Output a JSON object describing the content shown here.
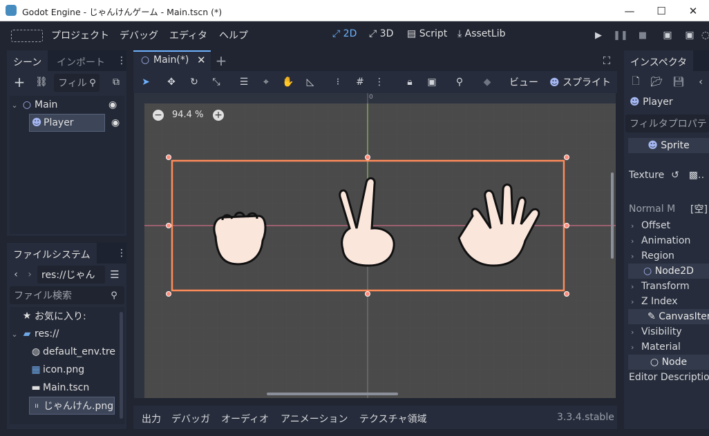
{
  "window": {
    "title": "Godot Engine - じゃんけんゲーム - Main.tscn (*)",
    "minimize": "—",
    "maximize": "☐",
    "close": "✕"
  },
  "menu": [
    "プロジェクト",
    "デバッグ",
    "エディタ",
    "ヘルプ"
  ],
  "workspaces": [
    "2D",
    "3D",
    "Script",
    "AssetLib"
  ],
  "scene_dock": {
    "tabs": [
      "シーン",
      "インポート"
    ],
    "filter_placeholder": "フィル",
    "nodes": [
      {
        "name": "Main"
      },
      {
        "name": "Player"
      }
    ]
  },
  "filesystem_dock": {
    "tab": "ファイルシステム",
    "path": "res://じゃん",
    "search_placeholder": "ファイル検索",
    "items": [
      {
        "label": "お気に入り:"
      },
      {
        "label": "res://"
      },
      {
        "label": "default_env.tre"
      },
      {
        "label": "icon.png"
      },
      {
        "label": "Main.tscn"
      },
      {
        "label": "じゃんけん.png"
      }
    ]
  },
  "editor": {
    "scene_tab": "Main(*)",
    "view_menu": "ビュー",
    "sprite_menu": "スプライト",
    "zoom": "94.4 %",
    "ruler_zero": "0"
  },
  "bottom_panel": {
    "tabs": [
      "出力",
      "デバッガ",
      "オーディオ",
      "アニメーション",
      "テクスチャ領域"
    ],
    "version": "3.3.4.stable"
  },
  "inspector": {
    "tab": "インスペクタ",
    "object": "Player",
    "filter_placeholder": "フィルタプロパテ",
    "sprite_section": "Sprite",
    "texture_label": "Texture",
    "normal_map_label": "Normal M",
    "normal_map_value": "[空]",
    "groups_a": [
      "Offset",
      "Animation",
      "Region"
    ],
    "node2d_section": "Node2D",
    "groups_b": [
      "Transform",
      "Z Index"
    ],
    "canvas_section": "CanvasIter",
    "groups_c": [
      "Visibility",
      "Material"
    ],
    "node_section": "Node",
    "editor_description": "Editor Description"
  },
  "colors": {
    "accent": "#6eb2ff",
    "selection": "#ff8c5a",
    "canvas_bg": "#4d4d4d"
  }
}
